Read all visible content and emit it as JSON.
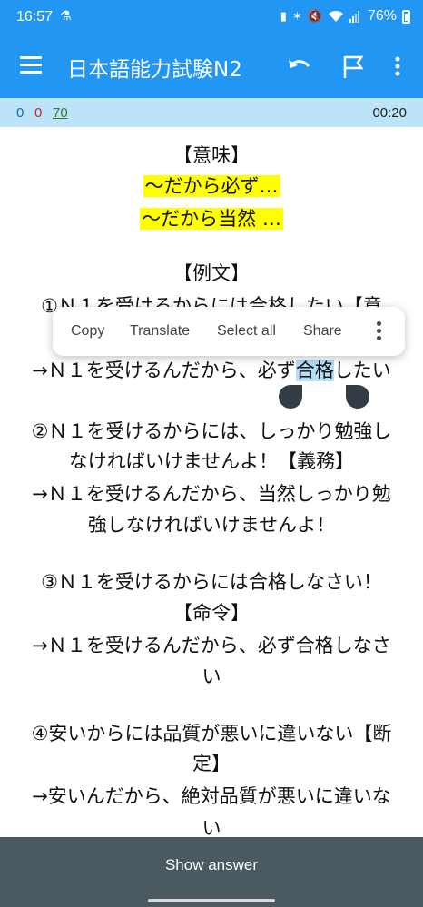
{
  "status_bar": {
    "time": "16:57",
    "notification_icon": "person-icon",
    "battery_percent": "76%",
    "icons": [
      "battery-saver-icon",
      "bluetooth-icon",
      "mute-icon",
      "wifi-icon",
      "signal-icon",
      "battery-icon"
    ]
  },
  "app_bar": {
    "title": "日本語能力試験N2",
    "icons": [
      "menu-icon",
      "undo-icon",
      "flag-icon",
      "more-vert-icon"
    ]
  },
  "stats": {
    "new_count": "0",
    "learning_count": "0",
    "review_count": "70",
    "timer": "00:20"
  },
  "card": {
    "meaning_header": "【意味】",
    "meaning_1": "〜だから必ず…",
    "meaning_2": "〜だから当然 …",
    "example_header": "【例文】",
    "ex1_line1": "①Ｎ１を受けるからには合格したい【意",
    "ex1_line2_before": "→Ｎ１を受けるんだから、必ず",
    "ex1_line2_selected": "合格",
    "ex1_line2_after": "したい",
    "ex2_line1": "②Ｎ１を受けるからには、しっかり勉強し",
    "ex2_line2": "なければいけませんよ！【義務】",
    "ex2_line3": "→Ｎ１を受けるんだから、当然しっかり勉",
    "ex2_line4": "強しなければいけませんよ！",
    "ex3_line1": "③Ｎ１を受けるからには合格しなさい！",
    "ex3_line2": "【命令】",
    "ex3_line3": "→Ｎ１を受けるんだから、必ず合格しなさ",
    "ex3_line4": "い",
    "ex4_line1": "④安いからには品質が悪いに違いない【断",
    "ex4_line2": "定】",
    "ex4_line3": "→安いんだから、絶対品質が悪いに違いな",
    "ex4_line4": "い"
  },
  "context_menu": {
    "copy": "Copy",
    "translate": "Translate",
    "select_all": "Select all",
    "share": "Share"
  },
  "bottom": {
    "show_answer": "Show answer"
  },
  "colors": {
    "primary": "#2196F3",
    "stats_bg": "#bde3f8",
    "highlight": "#ffff00",
    "selection": "#b3dcf5",
    "answer_bar": "#4b5961"
  }
}
